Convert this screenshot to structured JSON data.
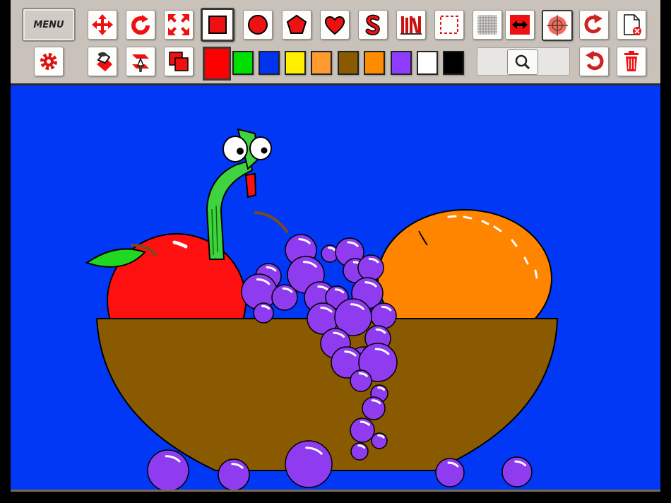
{
  "toolbar": {
    "menu_label": "MENU",
    "row1_tools": [
      "move-icon",
      "rotate-icon",
      "resize-icon",
      "square-shape-icon",
      "circle-shape-icon",
      "pentagon-shape-icon",
      "heart-shape-icon",
      "freehand-line-icon",
      "stamps-library-icon",
      "select-area-icon",
      "grid-icon",
      "flip-icon",
      "target-icon",
      "redo-icon",
      "new-page-icon"
    ],
    "row2_tools": [
      "settings-gear-icon",
      "fill-bucket-icon",
      "layer-order-icon",
      "duplicate-icon",
      "zoom-icon",
      "undo-icon",
      "trash-icon"
    ],
    "selected_tool": "square-shape-icon",
    "active_color": "#ff0000",
    "palette": [
      "#00e000",
      "#0033ee",
      "#ffee00",
      "#ff9a2e",
      "#8a5a00",
      "#ff8c00",
      "#8e3cff",
      "#ffffff",
      "#000000"
    ]
  },
  "canvas": {
    "background": "#0038f6",
    "objects": [
      "red-apple",
      "green-worm",
      "purple-grapes",
      "orange",
      "brown-bowl",
      "loose-grapes"
    ]
  }
}
